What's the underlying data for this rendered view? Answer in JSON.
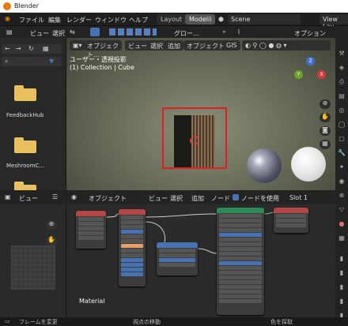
{
  "window": {
    "title": "Blender"
  },
  "menu": {
    "file": "ファイル",
    "edit": "編集",
    "render": "レンダー",
    "window": "ウィンドウ",
    "help": "ヘルプ"
  },
  "workspace_tabs": [
    "Layout",
    "Modelii"
  ],
  "scene": {
    "label": "Scene",
    "view_layer": "View Lay"
  },
  "file_browser": {
    "header": {
      "view": "ビュー",
      "select": "選択"
    },
    "items": [
      "FeedbackHub",
      "MeshroomC..."
    ]
  },
  "viewport_header": {
    "transform": "グロー...",
    "options": "オプション",
    "mode": "オブジェクト...",
    "view": "ビュー",
    "select": "選択",
    "add": "追加",
    "object": "オブジェクト",
    "gis": "GIS"
  },
  "viewport": {
    "info_line1": "ユーザー・透視投影",
    "info_line2": "(1) Collection | Cube",
    "gizmo_axes": [
      "Z",
      "Y",
      "X"
    ]
  },
  "image_editor": {
    "view": "ビュー"
  },
  "node_editor": {
    "mode": "オブジェクト",
    "view": "ビュー",
    "select": "選択",
    "add": "追加",
    "node": "ノード",
    "use_nodes": "ノードを使用",
    "slot": "Slot 1",
    "material_label": "Material"
  },
  "status": {
    "left": "フレームを変更",
    "mid": "視点の移動",
    "right": "色を採取"
  },
  "colors": {
    "accent": "#4772b3",
    "select_box": "#e02020",
    "folder": "#e8c05f"
  }
}
